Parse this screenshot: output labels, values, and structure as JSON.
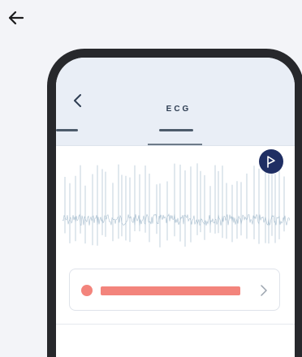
{
  "screen": {
    "title": "ECG"
  },
  "icons": {
    "back": "arrow-left-icon",
    "screen_back": "chevron-left-icon",
    "play": "play-icon",
    "card_chevron": "chevron-right-icon"
  },
  "colors": {
    "accent_navy": "#1f2e63",
    "waveform": "#a9bfd0",
    "status_salmon": "#f3847c",
    "header_bg": "#e9eef6"
  }
}
